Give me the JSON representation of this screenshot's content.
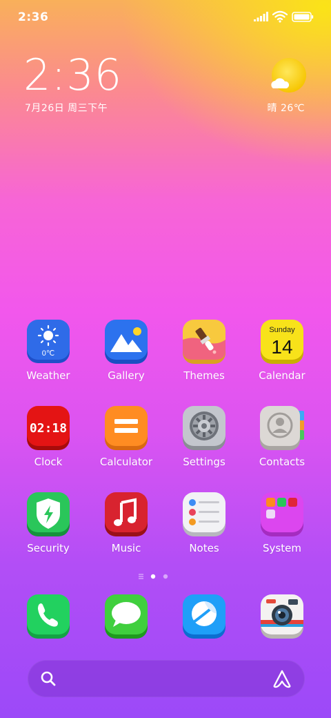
{
  "status_bar": {
    "time": "2:36"
  },
  "clock_widget": {
    "time": "2:36",
    "date": "7月26日 周三下午"
  },
  "weather_widget": {
    "text": "晴 26℃"
  },
  "apps": [
    {
      "label": "Weather",
      "icon": "weather-icon",
      "temp": "0℃"
    },
    {
      "label": "Gallery",
      "icon": "gallery-icon"
    },
    {
      "label": "Themes",
      "icon": "themes-icon"
    },
    {
      "label": "Calendar",
      "icon": "calendar-icon",
      "day_name": "Sunday",
      "day_num": "14"
    },
    {
      "label": "Clock",
      "icon": "clock-icon",
      "digits": "02:18"
    },
    {
      "label": "Calculator",
      "icon": "calculator-icon"
    },
    {
      "label": "Settings",
      "icon": "settings-icon"
    },
    {
      "label": "Contacts",
      "icon": "contacts-icon"
    },
    {
      "label": "Security",
      "icon": "security-icon"
    },
    {
      "label": "Music",
      "icon": "music-icon"
    },
    {
      "label": "Notes",
      "icon": "notes-icon"
    },
    {
      "label": "System",
      "icon": "system-folder-icon"
    }
  ],
  "dock": [
    {
      "icon": "phone-icon"
    },
    {
      "icon": "messages-icon"
    },
    {
      "icon": "browser-icon"
    },
    {
      "icon": "camera-icon"
    }
  ],
  "page_indicator": {
    "pages": 2,
    "current": 1
  },
  "colors": {
    "weather": "#2f63e6",
    "gallery": "#2a6ff0",
    "themes": "#f6c93a",
    "calendar": "#f7df1e",
    "clock": "#e01212",
    "calculator": "#ff8a1f",
    "settings": "#b9bcc4",
    "contacts": "#d9d6d3",
    "security": "#27c457",
    "music": "#d7232e",
    "notes": "#f1f1f4",
    "system": "#d43ee8",
    "phone": "#21d25f",
    "messages": "#3fcf3d",
    "browser": "#1e9df8",
    "camera": "#f4f2f1"
  }
}
